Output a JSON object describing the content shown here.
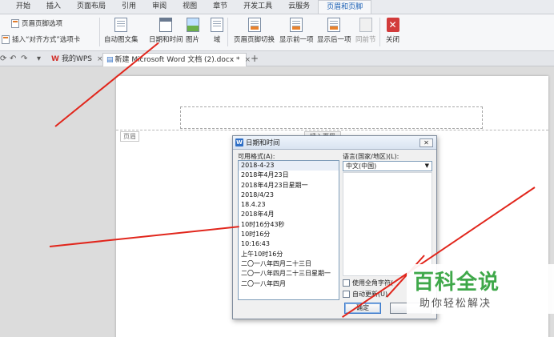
{
  "menu": {
    "items": [
      {
        "label": "开始"
      },
      {
        "label": "插入"
      },
      {
        "label": "页面布局"
      },
      {
        "label": "引用"
      },
      {
        "label": "审阅"
      },
      {
        "label": "视图"
      },
      {
        "label": "章节"
      },
      {
        "label": "开发工具"
      },
      {
        "label": "云服务"
      },
      {
        "label": "页眉和页脚",
        "active": true
      }
    ]
  },
  "ribbon": {
    "header_footer_options": "页眉页脚选项",
    "insert_align_tab": "插入“对齐方式”选项卡",
    "doc_parts": "自动图文集",
    "date_time": "日期和时间",
    "picture": "图片",
    "field": "域",
    "switch_header_footer": "页眉页脚切换",
    "show_previous": "显示前一项",
    "show_next": "显示后一项",
    "same_as_previous": "同前节",
    "close": "关闭"
  },
  "tabs": {
    "wps": "我的WPS",
    "document": "新建 Microsoft Word 文档 (2).docx *"
  },
  "page": {
    "header_tag": "页眉",
    "header_tool": "插入页眉"
  },
  "dialog": {
    "title": "日期和时间",
    "formats_label": "可用格式(A):",
    "formats": [
      "2018-4-23",
      "2018年4月23日",
      "2018年4月23日星期一",
      "2018/4/23",
      "18.4.23",
      "2018年4月",
      "10时16分43秒",
      "10时16分",
      "10:16:43",
      "上午10时16分",
      "二〇一八年四月二十三日",
      "二〇一八年四月二十三日星期一",
      "二〇一八年四月"
    ],
    "language_label": "语言(国家/地区)(L):",
    "language_value": "中文(中国)",
    "use_fullwidth": "使用全角字符(",
    "auto_update": "自动更新(U)",
    "ok": "确定",
    "cancel": ""
  },
  "watermark": {
    "main": "百科全说",
    "sub": "助你轻松解决"
  }
}
